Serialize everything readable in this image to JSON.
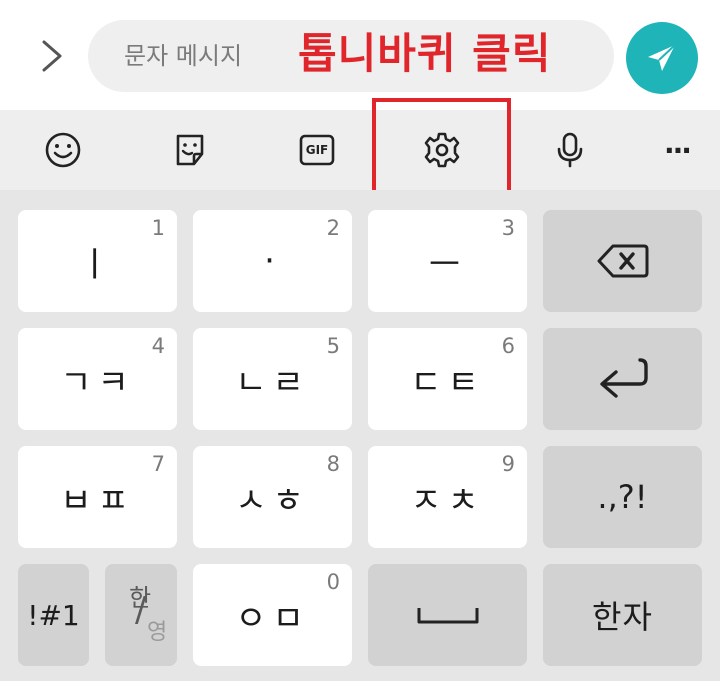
{
  "message_bar": {
    "placeholder": "문자 메시지",
    "caption": "톱니바퀴 클릭"
  },
  "toolbar": {
    "icons": [
      "emoji-icon",
      "sticker-icon",
      "gif-icon",
      "gear-icon",
      "microphone-icon",
      "more-icon"
    ],
    "gif_label": "GIF",
    "more_label": "···"
  },
  "keys": {
    "row1": [
      {
        "label": "ㅣ",
        "num": "1"
      },
      {
        "label": "·",
        "num": "2"
      },
      {
        "label": "ㅡ",
        "num": "3"
      }
    ],
    "row2": [
      {
        "label": "ㄱㅋ",
        "num": "4"
      },
      {
        "label": "ㄴㄹ",
        "num": "5"
      },
      {
        "label": "ㄷㅌ",
        "num": "6"
      }
    ],
    "row3": [
      {
        "label": "ㅂㅍ",
        "num": "7"
      },
      {
        "label": "ㅅㅎ",
        "num": "8"
      },
      {
        "label": "ㅈㅊ",
        "num": "9"
      }
    ],
    "punct": ".,?!",
    "symbols": "!#1",
    "lang_top": "한",
    "lang_bottom": "영",
    "lang_slash": "/",
    "zero": {
      "label": "ㅇㅁ",
      "num": "0"
    },
    "hanja": "한자"
  },
  "colors": {
    "accent": "#1fb4b8",
    "highlight": "#e0252b"
  }
}
